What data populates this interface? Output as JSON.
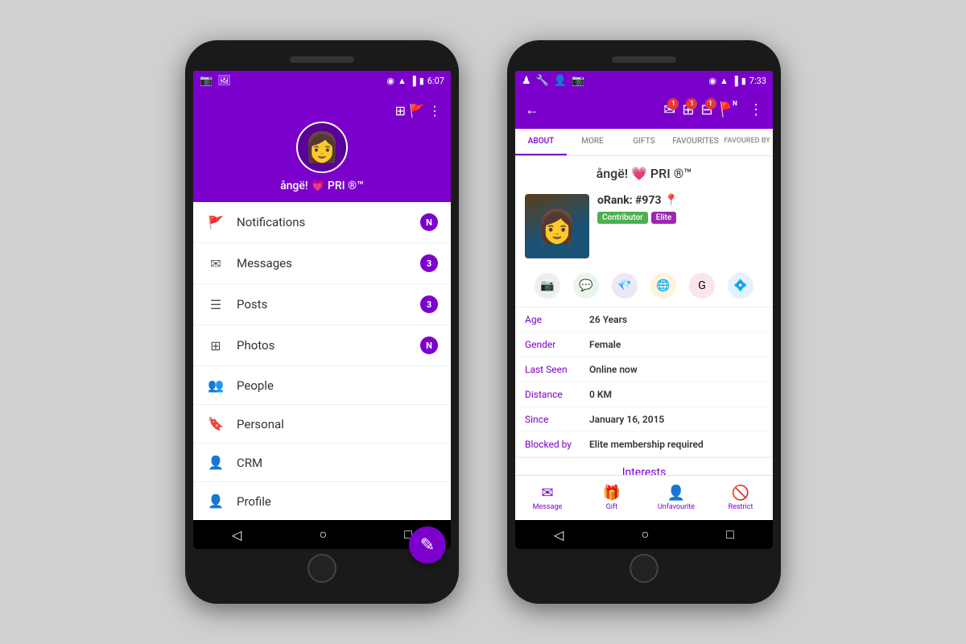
{
  "phone1": {
    "status_bar": {
      "time": "6:07",
      "icons": [
        "location",
        "wifi",
        "signal",
        "battery"
      ]
    },
    "header": {
      "username": "ångë! 💗 PRI ®™"
    },
    "menu_items": [
      {
        "id": "notifications",
        "label": "Notifications",
        "icon": "🚩",
        "badge": "N"
      },
      {
        "id": "messages",
        "label": "Messages",
        "icon": "✉",
        "badge": "3"
      },
      {
        "id": "posts",
        "label": "Posts",
        "icon": "☰",
        "badge": "3"
      },
      {
        "id": "photos",
        "label": "Photos",
        "icon": "⊞",
        "badge": "N"
      },
      {
        "id": "people",
        "label": "People",
        "icon": "👥",
        "badge": ""
      },
      {
        "id": "personal",
        "label": "Personal",
        "icon": "🔖",
        "badge": ""
      },
      {
        "id": "crm",
        "label": "CRM",
        "icon": "👤+",
        "badge": ""
      },
      {
        "id": "profile",
        "label": "Profile",
        "icon": "👤",
        "badge": ""
      }
    ],
    "fab_icon": "✎"
  },
  "phone2": {
    "status_bar": {
      "time": "7:33"
    },
    "toolbar": {
      "back_icon": "←",
      "action_icons": [
        "✉",
        "⊞",
        "⊟",
        "🚩",
        "⋮"
      ],
      "badges": [
        "1",
        "1",
        "1",
        "N"
      ]
    },
    "tabs": [
      "ABOUT",
      "MORE",
      "GIFTS",
      "FAVOURITES",
      "FAVOURED BY"
    ],
    "active_tab": "ABOUT",
    "profile": {
      "username": "ångë! 💗 PRI ®™",
      "rank": "oRank: #973",
      "rank_icon": "📍",
      "badges": [
        "Contributor",
        "Elite"
      ],
      "social_icons": [
        "📷",
        "💬",
        "💎",
        "🌐",
        "G",
        "💠"
      ],
      "info": {
        "age_label": "Age",
        "age_value": "26 Years",
        "gender_label": "Gender",
        "gender_value": "Female",
        "last_seen_label": "Last Seen",
        "last_seen_value": "Online now",
        "distance_label": "Distance",
        "distance_value": "0 KM",
        "since_label": "Since",
        "since_value": "January 16, 2015",
        "blocked_label": "Blocked by",
        "blocked_value": "Elite membership required"
      },
      "interests_label": "Interests"
    },
    "bottom_actions": [
      {
        "id": "message",
        "label": "Message",
        "icon": "✉"
      },
      {
        "id": "gift",
        "label": "Gift",
        "icon": "🎁"
      },
      {
        "id": "unfavourite",
        "label": "Unfavourite",
        "icon": "👤-"
      },
      {
        "id": "restrict",
        "label": "Restrict",
        "icon": "🚫"
      }
    ]
  }
}
